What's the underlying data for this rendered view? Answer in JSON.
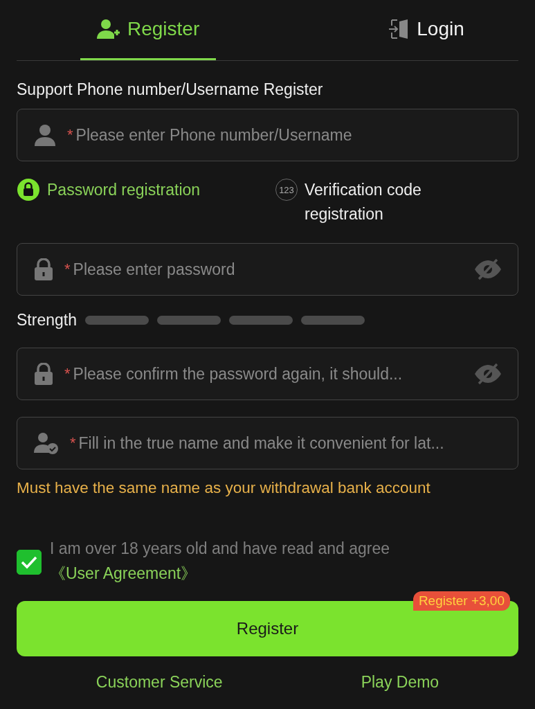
{
  "tabs": [
    {
      "kind": "register",
      "label": "Register",
      "selected": true
    },
    {
      "kind": "login",
      "label": "Login",
      "selected": false
    }
  ],
  "intro": "Support Phone number/Username Register",
  "fields_top": [
    {
      "kind": "user",
      "mark": "*",
      "placeholder": "Please enter Phone number/Username"
    }
  ],
  "modes": [
    {
      "kind": "password",
      "label": "Password registration",
      "selected": true
    },
    {
      "kind": "code",
      "badge": "123",
      "label": "Verification code registration",
      "selected": false
    }
  ],
  "fields": [
    {
      "kind": "password",
      "mark": "*",
      "placeholder": "Please enter password"
    }
  ],
  "strength": {
    "label": "Strength"
  },
  "fields_bottom": [
    {
      "kind": "password",
      "mark": "*",
      "placeholder": "Please confirm the password again, it should..."
    },
    {
      "kind": "realname",
      "mark": "*",
      "placeholder": "Fill in the true name and make it convenient for lat..."
    }
  ],
  "hint": "Must have the same name as your withdrawal bank account",
  "agreement": {
    "checked": true,
    "text": "I am over 18 years old and have read and agree",
    "link": "《User Agreement》"
  },
  "submit": {
    "label": "Register",
    "badge": "Register +3,00"
  },
  "footer_links": [
    "Customer Service",
    "Play Demo"
  ]
}
